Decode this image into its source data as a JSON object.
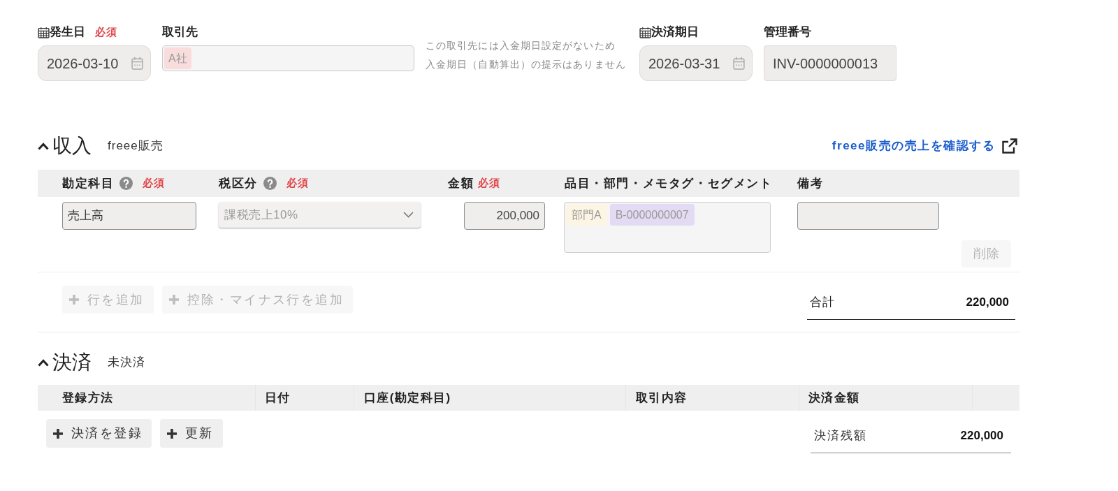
{
  "header_fields": [
    {
      "kind": "date",
      "label": "発生日",
      "badge": "必須",
      "value": "2026-03-10"
    },
    {
      "kind": "partner",
      "label": "取引先",
      "chips": [
        {
          "label": "A社",
          "color": "#f9dcdc"
        }
      ]
    },
    {
      "kind": "note",
      "lines": [
        "この取引先には入金期日設定がないため",
        "入金期日（自動算出）の提示はありません"
      ]
    },
    {
      "kind": "date",
      "label": "決済期日",
      "value": "2026-03-31"
    },
    {
      "kind": "text",
      "label": "管理番号",
      "value": "INV-0000000013"
    }
  ],
  "income": {
    "title": "収入",
    "subtitle": "freee販売",
    "expanded": true,
    "link": "freee販売の売上を確認する",
    "columns": [
      {
        "label": "勘定科目",
        "help": true,
        "badge": "必須"
      },
      {
        "label": "税区分",
        "help": true,
        "badge": "必須"
      },
      {
        "label": "金額",
        "badge": "必須"
      },
      {
        "label": "品目・部門・メモタグ・セグメント"
      },
      {
        "label": "備考"
      }
    ],
    "rows": [
      {
        "account": "売上高",
        "tax": {
          "value": "課税売上10%",
          "disabled": true
        },
        "amount": "200,000",
        "tags": [
          {
            "label": "部門A",
            "color": "#fdf5e3"
          },
          {
            "label": "B-0000000007",
            "color": "#e3dbf3"
          }
        ],
        "delete": {
          "label": "削除",
          "disabled": true
        }
      }
    ],
    "actions": [
      {
        "label": "行を追加",
        "disabled": true
      },
      {
        "label": "控除・マイナス行を追加",
        "disabled": true
      }
    ],
    "total": {
      "label": "合計",
      "value": "220,000"
    }
  },
  "settlement": {
    "title": "決済",
    "subtitle": "未決済",
    "expanded": true,
    "columns": [
      "登録方法",
      "日付",
      "口座(勘定科目)",
      "取引内容",
      "決済金額"
    ],
    "actions": [
      {
        "label": "決済を登録",
        "disabled": false
      },
      {
        "label": "更新",
        "disabled": false
      }
    ],
    "balance": {
      "label": "決済残額",
      "value": "220,000"
    }
  }
}
